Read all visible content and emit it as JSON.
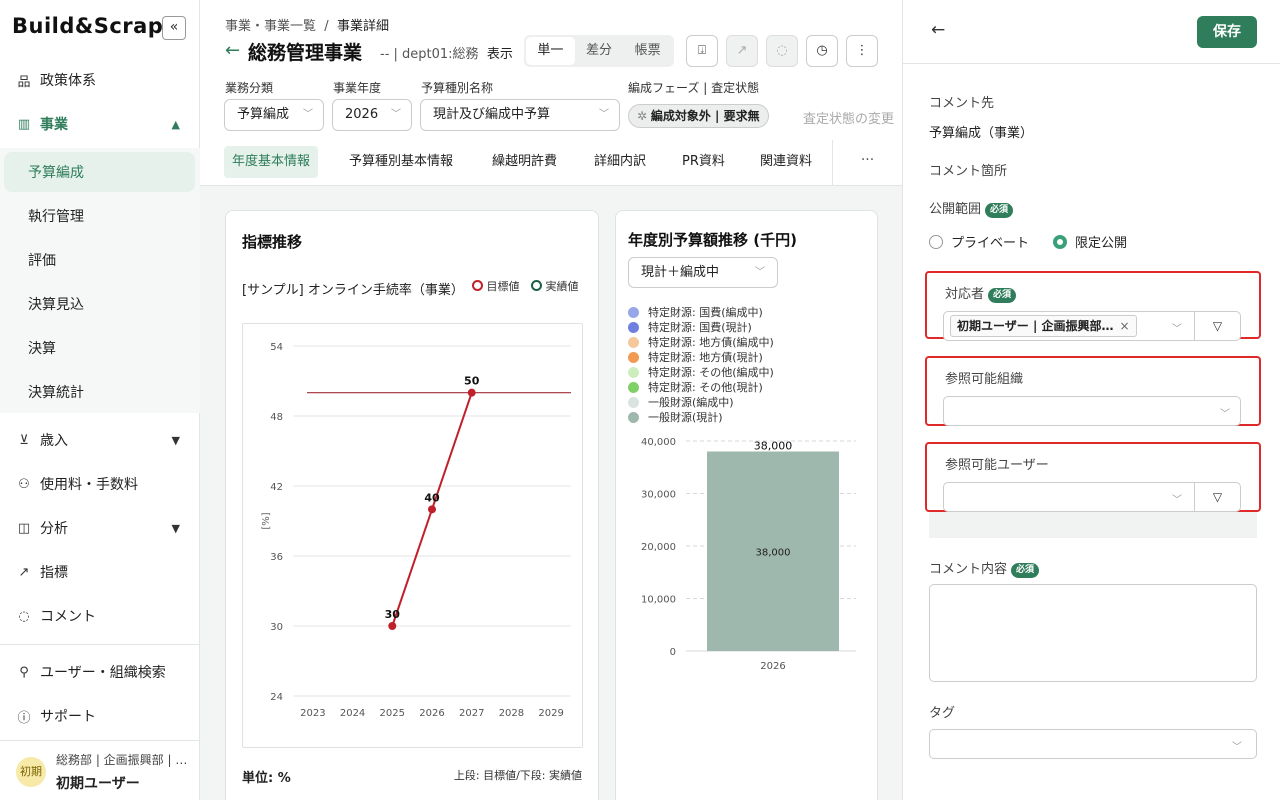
{
  "sidebar": {
    "logo": "Build&Scrap",
    "collapse_label": "«",
    "items": [
      {
        "label": "政策体系",
        "icon": "hierarchy-icon"
      },
      {
        "label": "事業",
        "icon": "bar-chart-icon"
      },
      {
        "label": "歳入",
        "icon": "revenue-icon"
      },
      {
        "label": "使用料・手数料",
        "icon": "fee-icon"
      },
      {
        "label": "分析",
        "icon": "analysis-icon"
      },
      {
        "label": "指標",
        "icon": "trend-icon"
      },
      {
        "label": "コメント",
        "icon": "comment-icon"
      }
    ],
    "sub_items": [
      "予算編成",
      "執行管理",
      "評価",
      "決算見込",
      "決算",
      "決算統計"
    ],
    "search_label": "ユーザー・組織検索",
    "support_label": "サポート",
    "user": {
      "avatar": "初期",
      "org": "総務部 | 企画振興部 | …",
      "name": "初期ユーザー"
    }
  },
  "header": {
    "breadcrumb_parent": "事業・事業一覧",
    "breadcrumb_sep": "/",
    "breadcrumb_current": "事業詳細",
    "title": "総務管理事業",
    "meta": "--  |  dept01:総務",
    "view_label": "表示",
    "view_modes": [
      "単一",
      "差分",
      "帳票"
    ]
  },
  "filters": {
    "category": {
      "label": "業務分類",
      "value": "予算編成"
    },
    "year": {
      "label": "事業年度",
      "value": "2026"
    },
    "budget_type": {
      "label": "予算種別名称",
      "value": "現計及び編成中予算"
    },
    "phase": {
      "label": "編成フェーズ | 査定状態",
      "value": "編成対象外 | 要求無",
      "muted": "査定状態の変更"
    }
  },
  "tabs": [
    "年度基本情報",
    "予算種別基本情報",
    "繰越明許費",
    "詳細内訳",
    "PR資料",
    "関連資料"
  ],
  "tabs_more": "···",
  "indicator_card": {
    "title": "指標推移",
    "subtitle": "[サンプル] オンライン手続率（事業）",
    "legend_target": "目標値",
    "legend_actual": "実績値",
    "unit": "単位: %",
    "note": "上段: 目標値/下段: 実績値"
  },
  "budget_card": {
    "title": "年度別予算額推移 (千円)",
    "select_value": "現計＋編成中",
    "legend": [
      {
        "label": "特定財源: 国費(編成中)",
        "color": "#97a6e8"
      },
      {
        "label": "特定財源: 国費(現計)",
        "color": "#6f7fe0"
      },
      {
        "label": "特定財源: 地方債(編成中)",
        "color": "#f6c79b"
      },
      {
        "label": "特定財源: 地方債(現計)",
        "color": "#f29a52"
      },
      {
        "label": "特定財源: その他(編成中)",
        "color": "#cdeebc"
      },
      {
        "label": "特定財源: その他(現計)",
        "color": "#7fd066"
      },
      {
        "label": "一般財源(編成中)",
        "color": "#d9e3df"
      },
      {
        "label": "一般財源(現計)",
        "color": "#9fb8ad"
      }
    ]
  },
  "chart_data": [
    {
      "type": "line",
      "title": "[サンプル] オンライン手続率（事業）",
      "ylabel": "[%]",
      "x": [
        "2023",
        "2024",
        "2025",
        "2026",
        "2027",
        "2028",
        "2029"
      ],
      "ylim": [
        24,
        54
      ],
      "yticks": [
        "54",
        "48",
        "42",
        "36",
        "30",
        "24"
      ],
      "target_line": 50,
      "series": [
        {
          "name": "実績値",
          "x": [
            "2025",
            "2026",
            "2027"
          ],
          "values": [
            30,
            40,
            50
          ],
          "labels": [
            "30",
            "40",
            "50"
          ]
        }
      ]
    },
    {
      "type": "bar",
      "categories": [
        "2026"
      ],
      "ylim": [
        0,
        40000
      ],
      "yticks": [
        "40,000",
        "30,000",
        "20,000",
        "10,000",
        "0"
      ],
      "values": [
        38000
      ],
      "total_label": "38,000",
      "inner_label": "38,000"
    }
  ],
  "panel": {
    "save_label": "保存",
    "comment_target_label": "コメント先",
    "comment_target_value": "予算編成（事業）",
    "comment_location_label": "コメント箇所",
    "scope_label": "公開範囲",
    "required": "必須",
    "scope_options": [
      "プライベート",
      "限定公開"
    ],
    "assignee_label": "対応者",
    "assignee_chip": "初期ユーザー | 企画振興部…",
    "org_label": "参照可能組織",
    "users_label": "参照可能ユーザー",
    "content_label": "コメント内容",
    "tag_label": "タグ"
  }
}
